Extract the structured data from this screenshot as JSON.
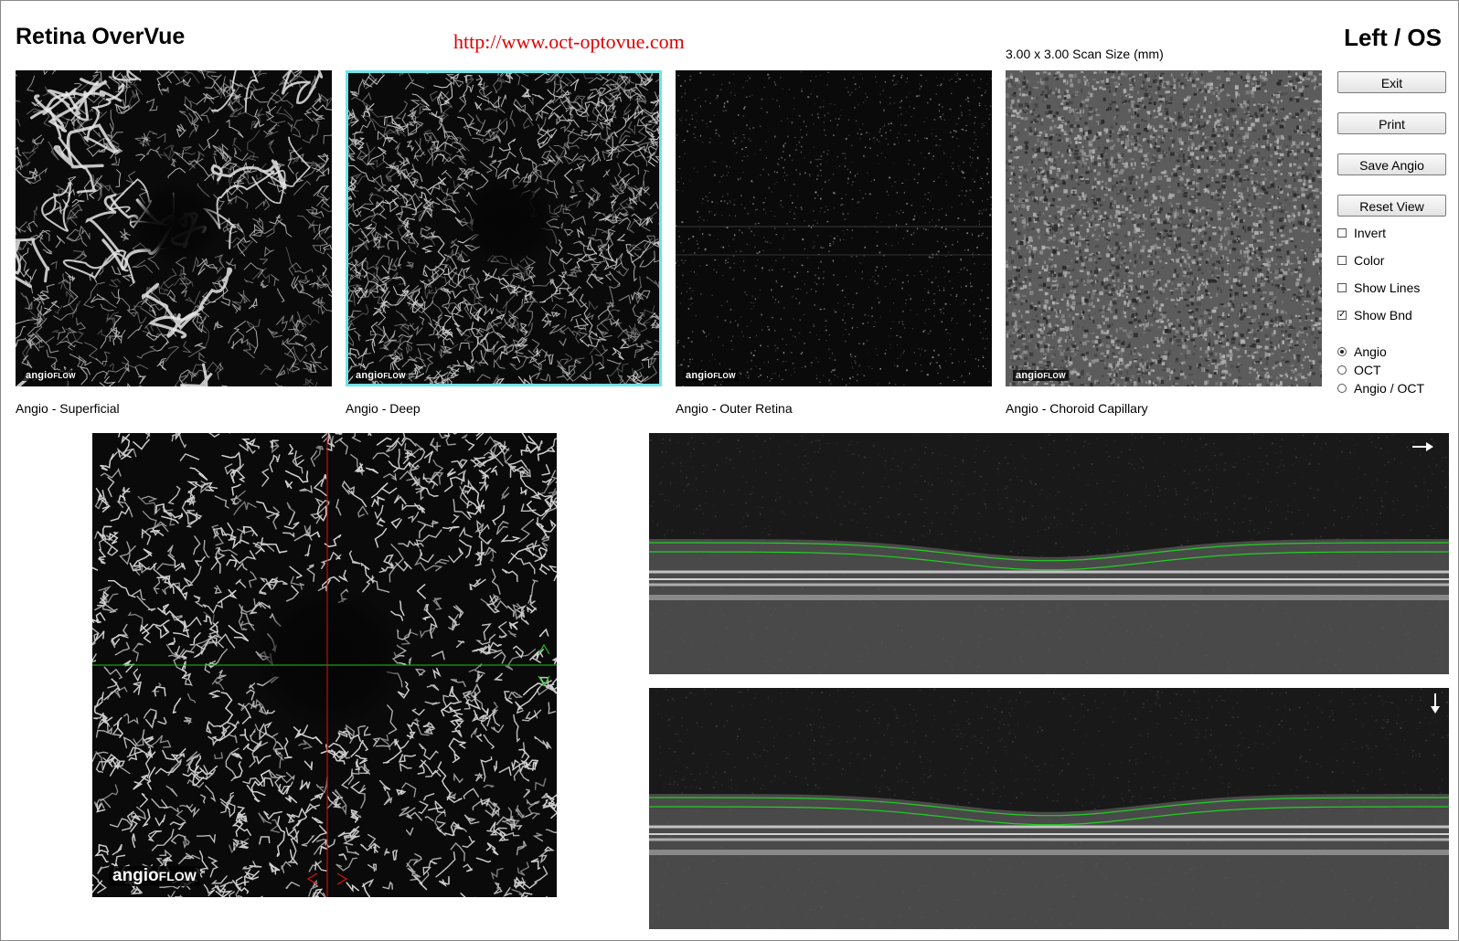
{
  "header": {
    "title": "Retina OverVue",
    "url": "http://www.oct-optovue.com",
    "eye": "Left / OS",
    "scan_size": "3.00 x 3.00 Scan Size (mm)"
  },
  "thumbnails": [
    {
      "label": "Angio - Superficial",
      "watermark_main": "angio",
      "watermark_sub": "FLOW",
      "selected": false
    },
    {
      "label": "Angio - Deep",
      "watermark_main": "angio",
      "watermark_sub": "FLOW",
      "selected": true
    },
    {
      "label": "Angio - Outer Retina",
      "watermark_main": "angio",
      "watermark_sub": "FLOW",
      "selected": false
    },
    {
      "label": "Angio - Choroid Capillary",
      "watermark_main": "angio",
      "watermark_sub": "FLOW",
      "selected": false
    }
  ],
  "buttons": {
    "exit": "Exit",
    "print": "Print",
    "save_angio": "Save Angio",
    "reset_view": "Reset View"
  },
  "checkboxes": [
    {
      "label": "Invert",
      "checked": false
    },
    {
      "label": "Color",
      "checked": false
    },
    {
      "label": "Show Lines",
      "checked": false
    },
    {
      "label": "Show Bnd",
      "checked": true
    }
  ],
  "view_mode": [
    {
      "label": "Angio",
      "selected": true
    },
    {
      "label": "OCT",
      "selected": false
    },
    {
      "label": "Angio / OCT",
      "selected": false
    }
  ],
  "main_view": {
    "watermark_main": "angio",
    "watermark_sub": "FLOW"
  },
  "colors": {
    "selection_outline": "#6fe3ea",
    "url_red": "#e00000",
    "vertical_crosshair": "#e01010",
    "horizontal_crosshair": "#19c419",
    "boundary_green": "#22d022"
  }
}
